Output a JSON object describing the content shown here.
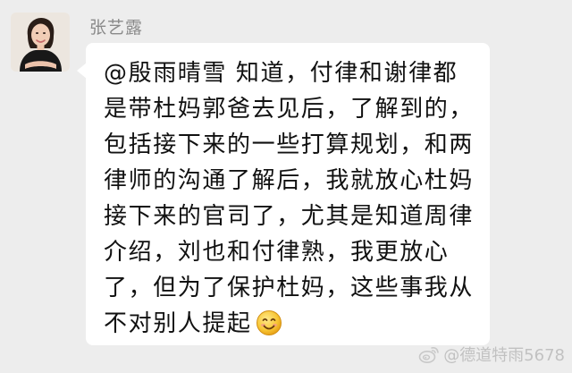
{
  "chat": {
    "sender": {
      "name": "张艺露",
      "avatar_icon": "profile-photo"
    },
    "message": {
      "lines": [
        "@殷雨晴雪  知道，付律和谢律都",
        "是带杜妈郭爸去见后，了解到的，",
        "包括接下来的一些打算规划，和两",
        "律师的沟通了解后，我就放心杜妈",
        "接下来的官司了，尤其是知道周律",
        "介绍，刘也和付律熟，我更放心",
        "了，但为了保护杜妈，这些事我从",
        "不对别人提起"
      ],
      "trailing_emoji": "smiling-face-emoji"
    }
  },
  "watermark": {
    "text": "@德道特雨5678",
    "icon": "weibo-icon"
  },
  "colors": {
    "background": "#ededed",
    "bubble": "#ffffff",
    "sender_name": "#8a8a8a",
    "message_text": "#111111"
  }
}
